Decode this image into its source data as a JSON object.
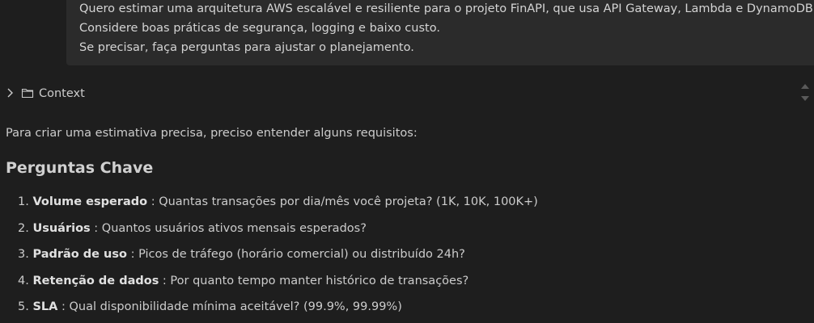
{
  "user_message": {
    "lines": [
      "Quero estimar uma arquitetura AWS escalável e resiliente para o projeto FinAPI, que usa API Gateway, Lambda e DynamoDB.",
      "Considere boas práticas de segurança, logging e baixo custo.",
      "Se precisar, faça perguntas para ajustar o planejamento."
    ]
  },
  "context": {
    "label": "Context",
    "icons": [
      "chevron-right-icon",
      "folder-icon"
    ]
  },
  "response": {
    "intro": "Para criar uma estimativa precisa, preciso entender alguns requisitos:",
    "heading": "Perguntas Chave",
    "questions": [
      {
        "number": "1.",
        "term": "Volume esperado",
        "text": " : Quantas transações por dia/mês você projeta? (1K, 10K, 100K+)"
      },
      {
        "number": "2.",
        "term": "Usuários",
        "text": " : Quantos usuários ativos mensais esperados?"
      },
      {
        "number": "3.",
        "term": "Padrão de uso",
        "text": " : Picos de tráfego (horário comercial) ou distribuído 24h?"
      },
      {
        "number": "4.",
        "term": "Retenção de dados",
        "text": " : Por quanto tempo manter histórico de transações?"
      },
      {
        "number": "5.",
        "term": "SLA",
        "text": " : Qual disponibilidade mínima aceitável? (99.9%, 99.99%)"
      }
    ]
  },
  "colors": {
    "background": "#1e1e1e",
    "message_bubble": "#2b2b2b",
    "text": "#cccccc"
  }
}
